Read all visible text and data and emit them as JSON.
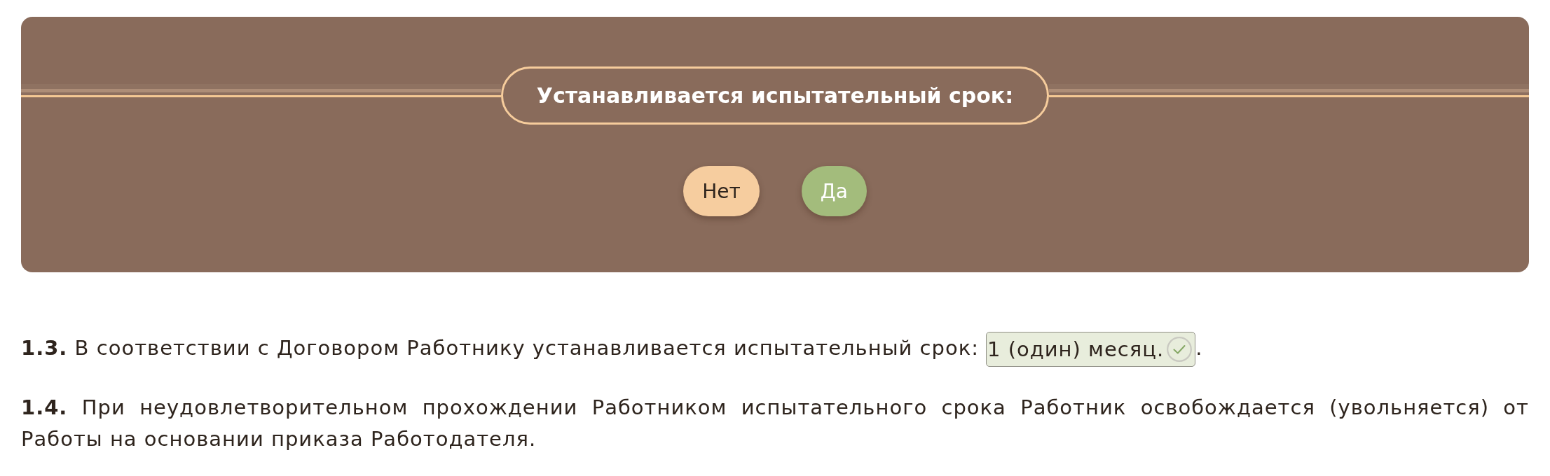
{
  "question_panel": {
    "title": "Устанавливается испытательный срок:",
    "options": [
      {
        "label": "Нет",
        "selected": false
      },
      {
        "label": "Да",
        "selected": true
      }
    ]
  },
  "clauses": [
    {
      "text": "**1.3.** В соответствии с Договором Работнику устанавливается испытательный срок:",
      "field": {
        "value": "1 (один) месяц.",
        "confirmed": true
      },
      "suffix": "."
    },
    {
      "text": "**1.4.** При неудовлетворительном прохождении Работником испытательного срока Работник освобождается (увольняется) от Работы на основании приказа Работодателя."
    }
  ]
}
